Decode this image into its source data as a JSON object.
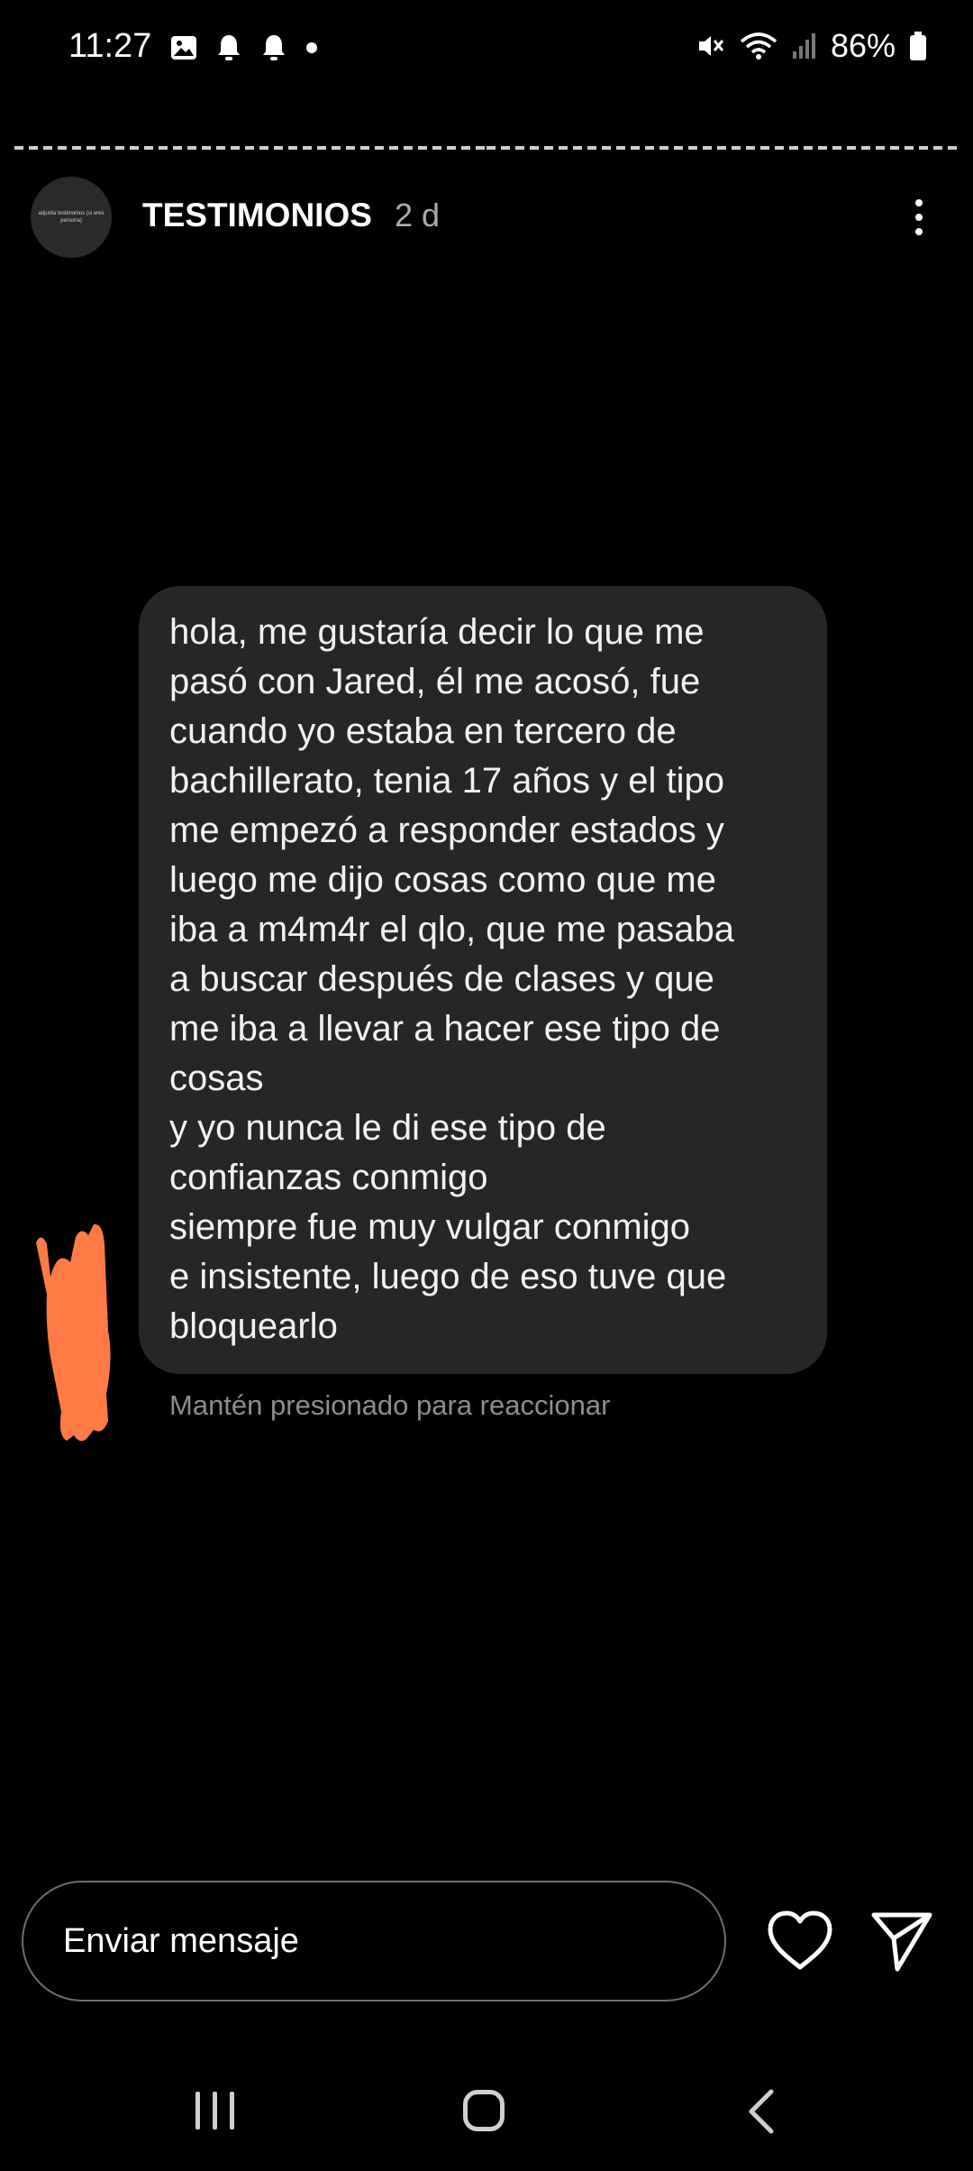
{
  "status_bar": {
    "time": "11:27",
    "battery": "86%",
    "icons": [
      "image-icon",
      "notification-bell-icon",
      "notification-bell-icon",
      "dot-icon",
      "mute-icon",
      "wifi-icon",
      "signal-icon",
      "battery-icon"
    ]
  },
  "story": {
    "account_name": "TESTIMONIOS",
    "age": "2 d",
    "avatar_text": "adjunta testimonios (si eres persona)",
    "progress_segments": 2,
    "message_lines": [
      "hola, me gustaría decir lo que me",
      "pasó con Jared, él me acosó, fue",
      "cuando yo estaba en tercero de",
      "bachillerato, tenia 17 años y el tipo",
      "me empezó a responder estados y",
      "luego me dijo cosas como que me",
      "iba a m4m4r el qlo, que me pasaba",
      "a buscar después de clases y que",
      "me iba a llevar a hacer ese tipo de",
      "cosas",
      "y yo nunca le di ese tipo de",
      "confianzas conmigo",
      "siempre fue muy vulgar conmigo",
      "e insistente, luego de eso tuve que",
      "bloquearlo"
    ],
    "hint": "Mantén presionado para reaccionar",
    "redaction_color": "#ff7a45"
  },
  "reply_bar": {
    "placeholder": "Enviar mensaje"
  },
  "colors": {
    "background": "#000000",
    "bubble": "#262626",
    "muted_text": "#8e8e8e"
  }
}
